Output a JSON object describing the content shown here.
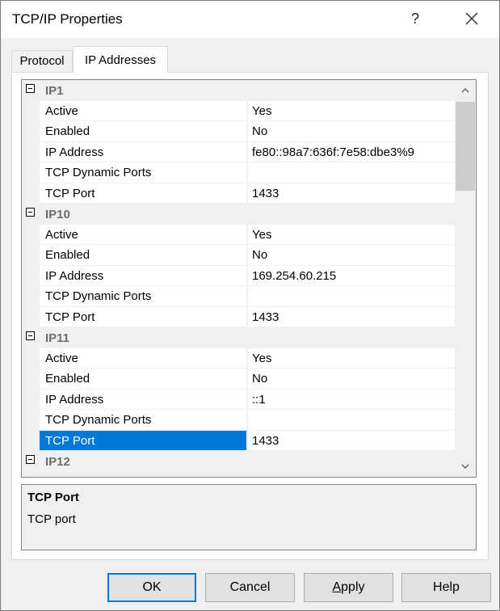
{
  "window": {
    "title": "TCP/IP Properties",
    "help_label": "?"
  },
  "tabs": [
    {
      "label": "Protocol",
      "active": false
    },
    {
      "label": "IP Addresses",
      "active": true
    }
  ],
  "grid": {
    "categories": [
      {
        "name": "IP1",
        "props": [
          {
            "name": "Active",
            "value": "Yes"
          },
          {
            "name": "Enabled",
            "value": "No"
          },
          {
            "name": "IP Address",
            "value": "fe80::98a7:636f:7e58:dbe3%9"
          },
          {
            "name": "TCP Dynamic Ports",
            "value": ""
          },
          {
            "name": "TCP Port",
            "value": "1433"
          }
        ]
      },
      {
        "name": "IP10",
        "props": [
          {
            "name": "Active",
            "value": "Yes"
          },
          {
            "name": "Enabled",
            "value": "No"
          },
          {
            "name": "IP Address",
            "value": "169.254.60.215"
          },
          {
            "name": "TCP Dynamic Ports",
            "value": ""
          },
          {
            "name": "TCP Port",
            "value": "1433"
          }
        ]
      },
      {
        "name": "IP11",
        "props": [
          {
            "name": "Active",
            "value": "Yes"
          },
          {
            "name": "Enabled",
            "value": "No"
          },
          {
            "name": "IP Address",
            "value": "::1"
          },
          {
            "name": "TCP Dynamic Ports",
            "value": ""
          },
          {
            "name": "TCP Port",
            "value": "1433",
            "selected": true
          }
        ]
      },
      {
        "name": "IP12",
        "props": []
      }
    ]
  },
  "description": {
    "title": "TCP Port",
    "text": "TCP port"
  },
  "buttons": {
    "ok": "OK",
    "cancel": "Cancel",
    "apply_accel": "A",
    "apply_rest": "pply",
    "help": "Help"
  },
  "colors": {
    "selection": "#0078d7",
    "dialog_bg": "#f0f0f0",
    "category_text": "#6d6d6d"
  }
}
